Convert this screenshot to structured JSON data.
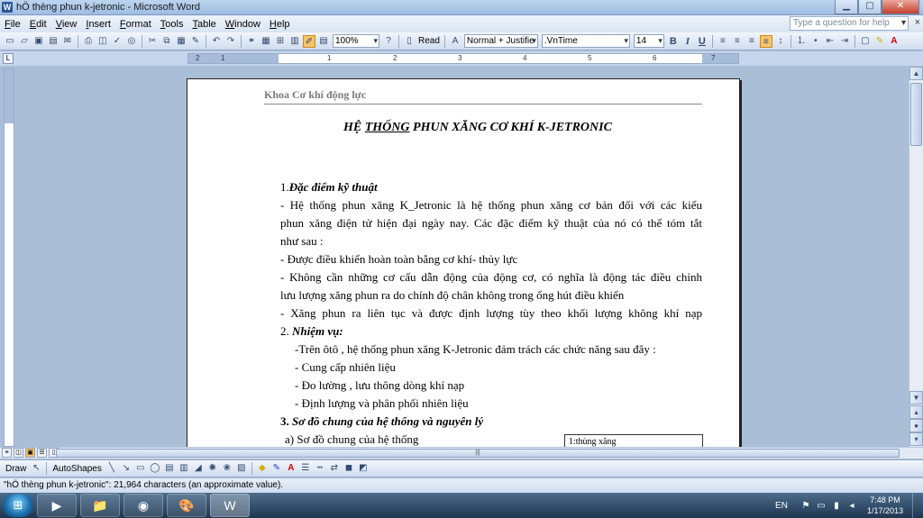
{
  "window": {
    "title": "hÖ thèng phun k-jetronic - Microsoft Word",
    "app_icon": "W",
    "min_glyph": "▁",
    "max_glyph": "▢",
    "close_glyph": "✕"
  },
  "menubar": {
    "items": [
      "File",
      "Edit",
      "View",
      "Insert",
      "Format",
      "Tools",
      "Table",
      "Window",
      "Help"
    ],
    "help_placeholder": "Type a question for help",
    "close_glyph": "×"
  },
  "toolbar": {
    "zoom": "100%",
    "read_label": "Read",
    "style": "Normal + Justifie",
    "font": ".VnTime",
    "font_size": "14",
    "bold": "B",
    "italic": "I",
    "underline": "U"
  },
  "ruler": {
    "numbers": [
      "1",
      "2",
      "1",
      "2",
      "3",
      "4",
      "5",
      "6",
      "7"
    ]
  },
  "document": {
    "header": "Khoa Cơ khí động lực",
    "title_pre": "HỆ ",
    "title_underlined": "THỐNG",
    "title_post": " PHUN XĂNG CƠ KHÍ  K-JETRONIC",
    "section1_number": "1.",
    "section1_title": "Đặc điểm kỹ thuật",
    "p1_line1": "-  Hệ thống phun xăng K_Jetronic là hệ thống phun xăng cơ bản đối với các kiểu",
    "p1_line2": "phun xăng điện tử hiện đại ngày nay. Các đặc điểm kỹ thuật của nó có thể tóm tắt",
    "p1_line3": "như sau :",
    "p2": "-  Được điều khiển hoàn toàn bằng cơ khí- thủy lực",
    "p3_line1": "-  Không cần những cơ cấu dẫn động của động cơ, có nghĩa là động tác điều chỉnh",
    "p3_line2": "lưu lượng xăng phun ra do chính độ chân không trong ống hút điều khiển",
    "p4": "-  Xăng phun ra liên tục và được định lượng tùy theo khối lượng không khí nạp",
    "section2_number": "2.",
    "section2_title": " Nhiệm vụ:",
    "p5": "-Trên ôtô , hệ thống phun xăng K-Jetronic đảm trách các chức năng sau đây :",
    "p6": "-  Cung cấp nhiên liệu",
    "p7": "-  Đo lường , lưu thông dòng khí nạp",
    "p8": "-  Định lượng và phân phối nhiên liệu",
    "section3_number": "3. ",
    "section3_title": "Sơ đồ chung của hệ thống và nguyên lý",
    "p9": "a) Sơ đồ chung của hệ thống",
    "textbox": "1:thùng xăng"
  },
  "drawbar": {
    "draw": "Draw",
    "autoshapes": "AutoShapes"
  },
  "statusbar": {
    "text": "\"hÖ thèng phun k-jetronic\": 21,964 characters (an approximate value)."
  },
  "taskbar": {
    "start_glyph": "⊞",
    "apps": [
      "▶",
      "📁",
      "◉",
      "🎨",
      "W"
    ],
    "lang": "EN",
    "time": "7:48 PM",
    "date": "1/17/2013"
  }
}
